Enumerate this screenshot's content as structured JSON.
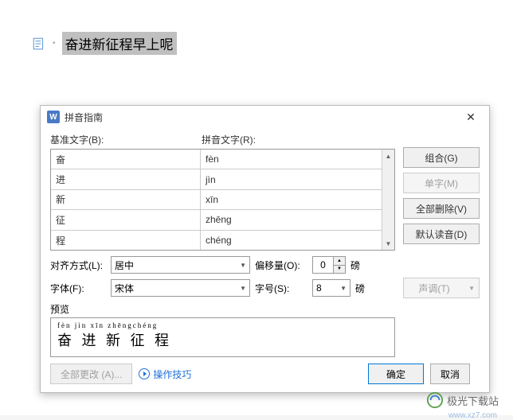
{
  "doc": {
    "selected_text": "奋进新征程早上呢"
  },
  "dialog": {
    "title": "拼音指南",
    "headers": {
      "base": "基准文字(B):",
      "ruby": "拼音文字(R):"
    },
    "rows": [
      {
        "b": "奋",
        "r": "fèn"
      },
      {
        "b": "进",
        "r": "jìn"
      },
      {
        "b": "新",
        "r": "xīn"
      },
      {
        "b": "征",
        "r": "zhēng"
      },
      {
        "b": "程",
        "r": "chéng"
      }
    ],
    "side": {
      "combine": "组合(G)",
      "single": "单字(M)",
      "clear_all": "全部删除(V)",
      "default_reading": "默认读音(D)",
      "tone": "声调(T)"
    },
    "labels": {
      "align": "对齐方式(L):",
      "offset": "偏移量(O):",
      "font": "字体(F):",
      "size": "字号(S):",
      "unit": "磅",
      "preview": "预览"
    },
    "values": {
      "align": "居中",
      "offset": "0",
      "font": "宋体",
      "size": "8"
    },
    "preview": {
      "ruby": "fèn jìn xīn zhēngchéng",
      "base": "奋 进 新 征 程"
    },
    "footer": {
      "change_all": "全部更改 (A)...",
      "tips": "操作技巧",
      "ok": "确定",
      "cancel": "取消"
    }
  },
  "watermark": {
    "text": "极光下载站",
    "url": "www.xz7.com"
  },
  "chart_data": {
    "type": "table",
    "title": "拼音指南",
    "columns": [
      "基准文字",
      "拼音文字"
    ],
    "rows": [
      [
        "奋",
        "fèn"
      ],
      [
        "进",
        "jìn"
      ],
      [
        "新",
        "xīn"
      ],
      [
        "征",
        "zhēng"
      ],
      [
        "程",
        "chéng"
      ]
    ]
  }
}
